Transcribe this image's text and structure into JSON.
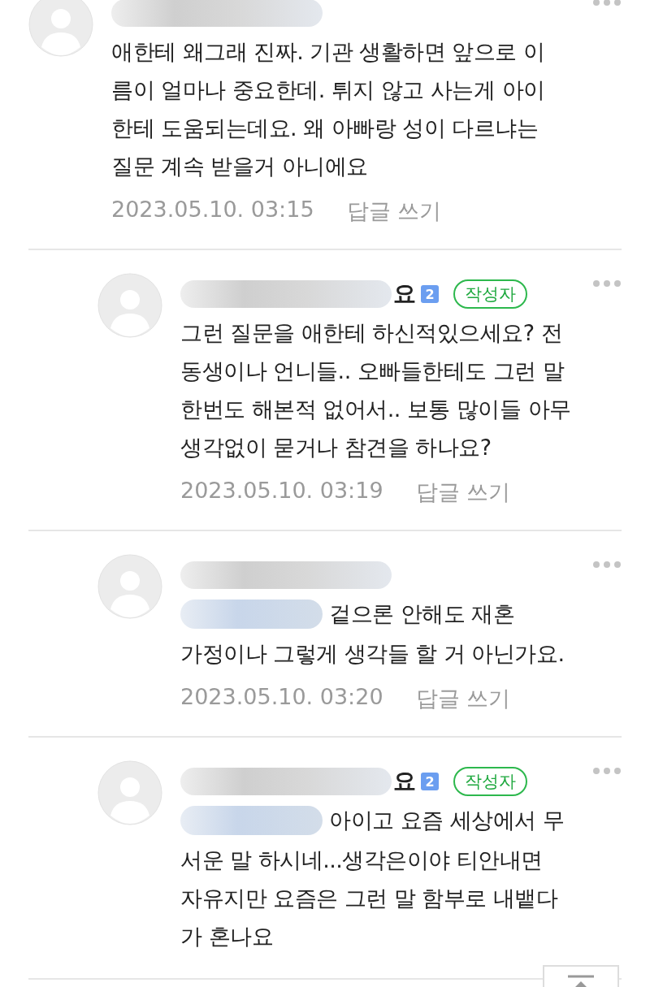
{
  "comments": [
    {
      "reply": false,
      "body": "애한테 왜그래 진짜. 기관 생활하면 앞으로 이\n름이 얼마나 중요한데. 튀지 않고 사는게 아이\n한테 도움되는데요. 왜 아빠랑 성이 다르냐는\n질문 계속 받을거 아니에요",
      "date": "2023.05.10. 03:15",
      "reply_link": "답글 쓰기"
    },
    {
      "reply": true,
      "name_tail": "요",
      "level_badge": "2",
      "author_tag": "작성자",
      "body": "그런 질문을 애한테 하신적있으세요? 전\n동생이나 언니들.. 오빠들한테도 그런 말\n한번도 해본적 없어서.. 보통 많이들 아무\n생각없이 묻거나 참견을 하나요?",
      "date": "2023.05.10. 03:19",
      "reply_link": "답글 쓰기"
    },
    {
      "reply": true,
      "mention_hidden": true,
      "mention_lead": "겉으론 안해도 재혼",
      "body": "가정이나 그렇게 생각들 할 거 아닌가요.",
      "date": "2023.05.10. 03:20",
      "reply_link": "답글 쓰기"
    },
    {
      "reply": true,
      "name_tail": "요",
      "level_badge": "2",
      "author_tag": "작성자",
      "mention_hidden": true,
      "mention_lead": "아이고 요즘 세상에서 무",
      "body": "서운 말 하시네...생각은이야 티안내면\n자유지만 요즘은 그런 말 함부로 내뱉다\n가 혼나요"
    }
  ]
}
